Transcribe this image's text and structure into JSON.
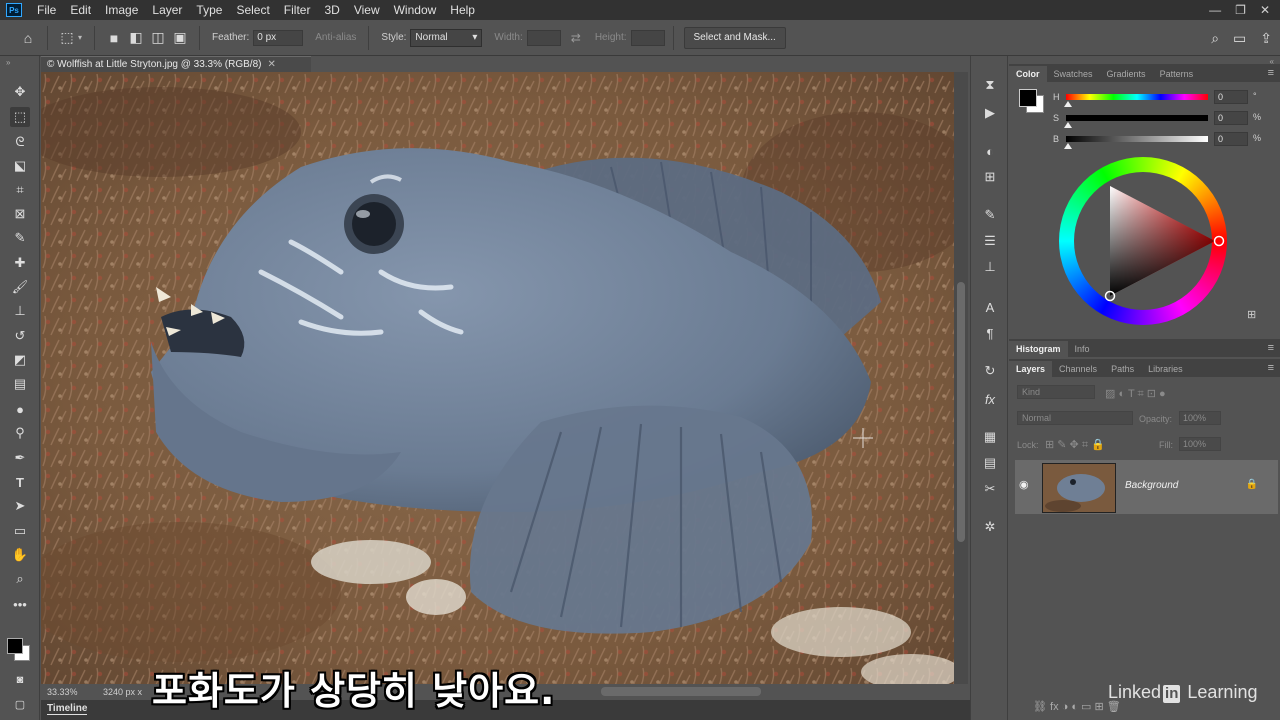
{
  "menu": [
    "File",
    "Edit",
    "Image",
    "Layer",
    "Type",
    "Select",
    "Filter",
    "3D",
    "View",
    "Window",
    "Help"
  ],
  "window_controls": [
    "—",
    "❐",
    "✕"
  ],
  "options": {
    "feather_label": "Feather:",
    "feather_value": "0 px",
    "antialias_label": "Anti-alias",
    "style_label": "Style:",
    "style_value": "Normal",
    "width_label": "Width:",
    "height_label": "Height:",
    "select_mask_label": "Select and Mask..."
  },
  "document": {
    "tab_title": "© Wolffish at Little Stryton.jpg @ 33.3% (RGB/8)",
    "zoom": "33.33%",
    "size_info": "3240 px x"
  },
  "timeline_label": "Timeline",
  "color_panel": {
    "tabs": [
      "Color",
      "Swatches",
      "Gradients",
      "Patterns"
    ],
    "h_label": "H",
    "h_value": "0",
    "h_unit": "°",
    "s_label": "S",
    "s_value": "0",
    "s_unit": "%",
    "b_label": "B",
    "b_value": "0",
    "b_unit": "%"
  },
  "histogram_tabs": [
    "Histogram",
    "Info"
  ],
  "layers_panel": {
    "tabs": [
      "Layers",
      "Channels",
      "Paths",
      "Libraries"
    ],
    "kind_label": "Kind",
    "blend_mode": "Normal",
    "opacity_label": "Opacity:",
    "opacity_value": "100%",
    "lock_label": "Lock:",
    "fill_label": "Fill:",
    "fill_value": "100%",
    "layer_name": "Background"
  },
  "subtitle": "포화도가 상당히 낮아요.",
  "watermark": {
    "left": "Linked",
    "in": "in",
    "right": "Learning"
  },
  "colors": {
    "fish": "#6f7f95",
    "background_reef": "#7a5a3e",
    "accent_ps": "#31a8ff"
  }
}
